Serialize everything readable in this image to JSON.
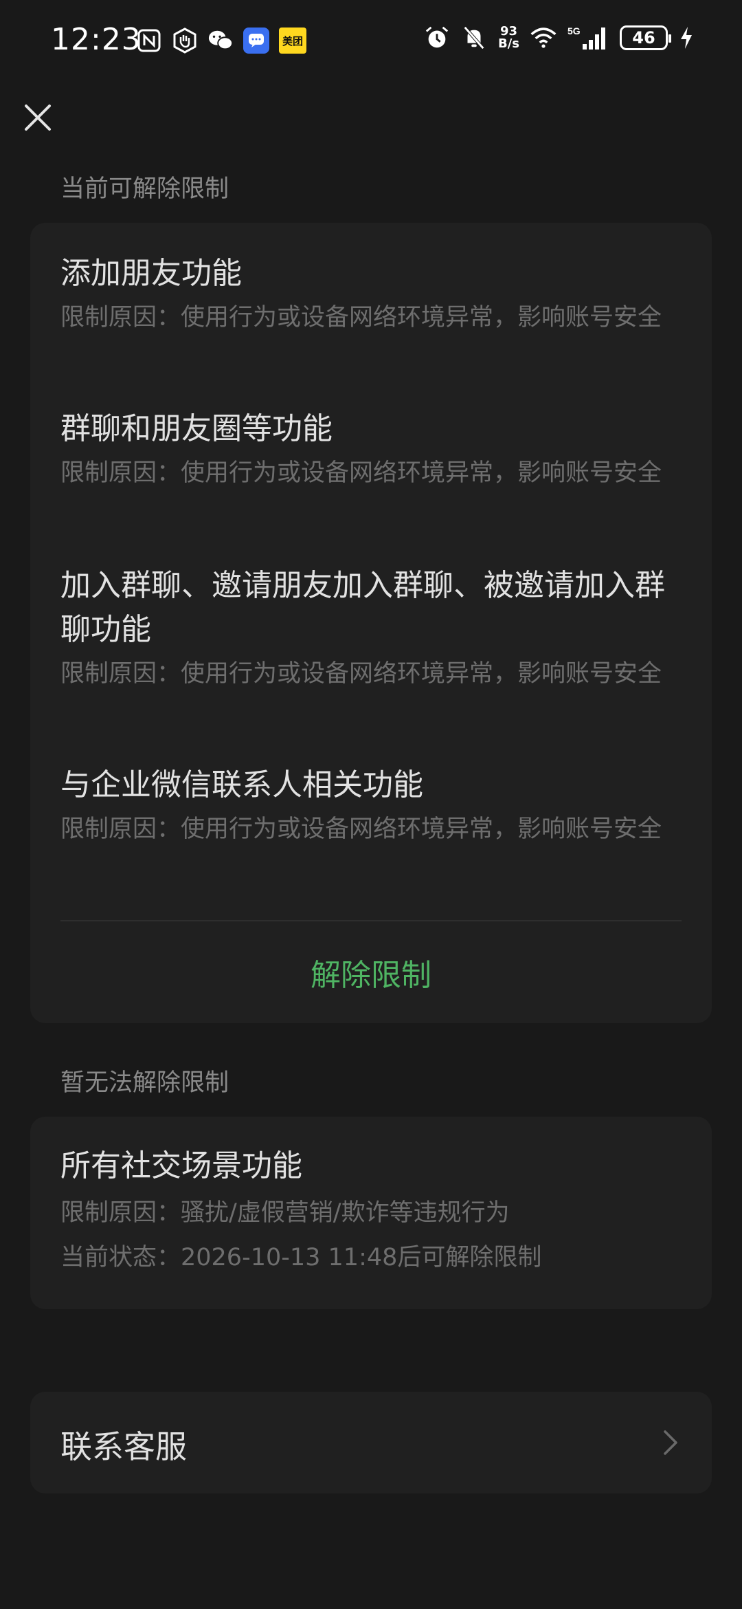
{
  "status_bar": {
    "time": "12:23",
    "left_icons": [
      "nfc-icon",
      "hand-icon",
      "wechat-icon",
      "message-app-icon",
      "meituan-app-icon"
    ],
    "meituan_label": "美团",
    "net_speed_value": "93",
    "net_speed_unit": "B/s",
    "network": "5G",
    "battery": "46"
  },
  "header": {
    "close_icon": "close-icon"
  },
  "removable_section": {
    "label": "当前可解除限制",
    "items": [
      {
        "title": "添加朋友功能",
        "reason": "限制原因：使用行为或设备网络环境异常，影响账号安全"
      },
      {
        "title": "群聊和朋友圈等功能",
        "reason": "限制原因：使用行为或设备网络环境异常，影响账号安全"
      },
      {
        "title": "加入群聊、邀请朋友加入群聊、被邀请加入群聊功能",
        "reason": "限制原因：使用行为或设备网络环境异常，影响账号安全"
      },
      {
        "title": "与企业微信联系人相关功能",
        "reason": "限制原因：使用行为或设备网络环境异常，影响账号安全"
      }
    ],
    "button_label": "解除限制"
  },
  "blocked_section": {
    "label": "暂无法解除限制",
    "item": {
      "title": "所有社交场景功能",
      "reason": "限制原因：骚扰/虚假营销/欺诈等违规行为",
      "status": "当前状态：2026-10-13 11:48后可解除限制"
    }
  },
  "contact": {
    "label": "联系客服"
  },
  "colors": {
    "background": "#191919",
    "card": "#202020",
    "accent_green": "#4fb463"
  }
}
